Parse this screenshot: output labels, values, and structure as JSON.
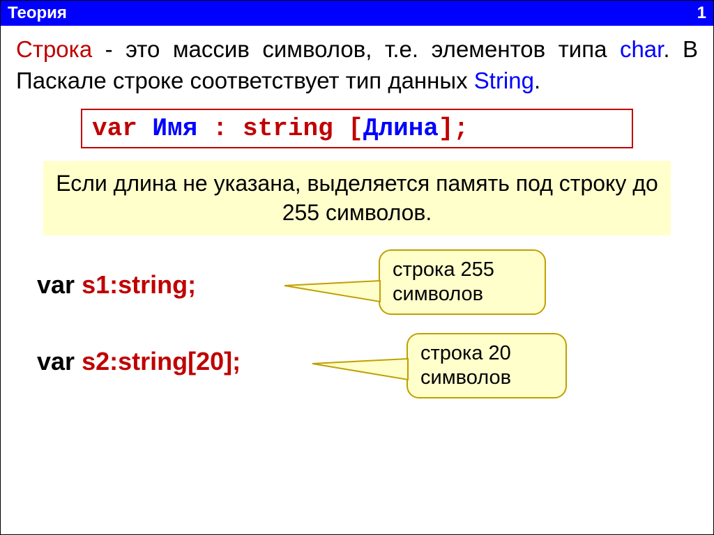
{
  "header": {
    "title": "Теория",
    "page": "1"
  },
  "paragraph": {
    "w1": "Строка",
    "t1": " - это массив символов, т.е. элементов типа ",
    "w2": "char",
    "t2": ". В Паскале строке соответствует тип данных ",
    "w3": "String",
    "t3": "."
  },
  "syntax": {
    "kw_var": "var",
    "name": " Имя ",
    "colon_type": ": string ",
    "lbr": "[",
    "len": "Длина",
    "rbr_semi": "];"
  },
  "note": "Если длина не указана, выделяется память под строку до 255 символов.",
  "examples": {
    "ex1": {
      "kw": "var",
      "decl": "  s1:string;"
    },
    "ex2": {
      "kw": "var",
      "decl": "  s2:string[20];"
    }
  },
  "callouts": {
    "c1": "строка 255 символов",
    "c2": "строка 20 символов"
  }
}
